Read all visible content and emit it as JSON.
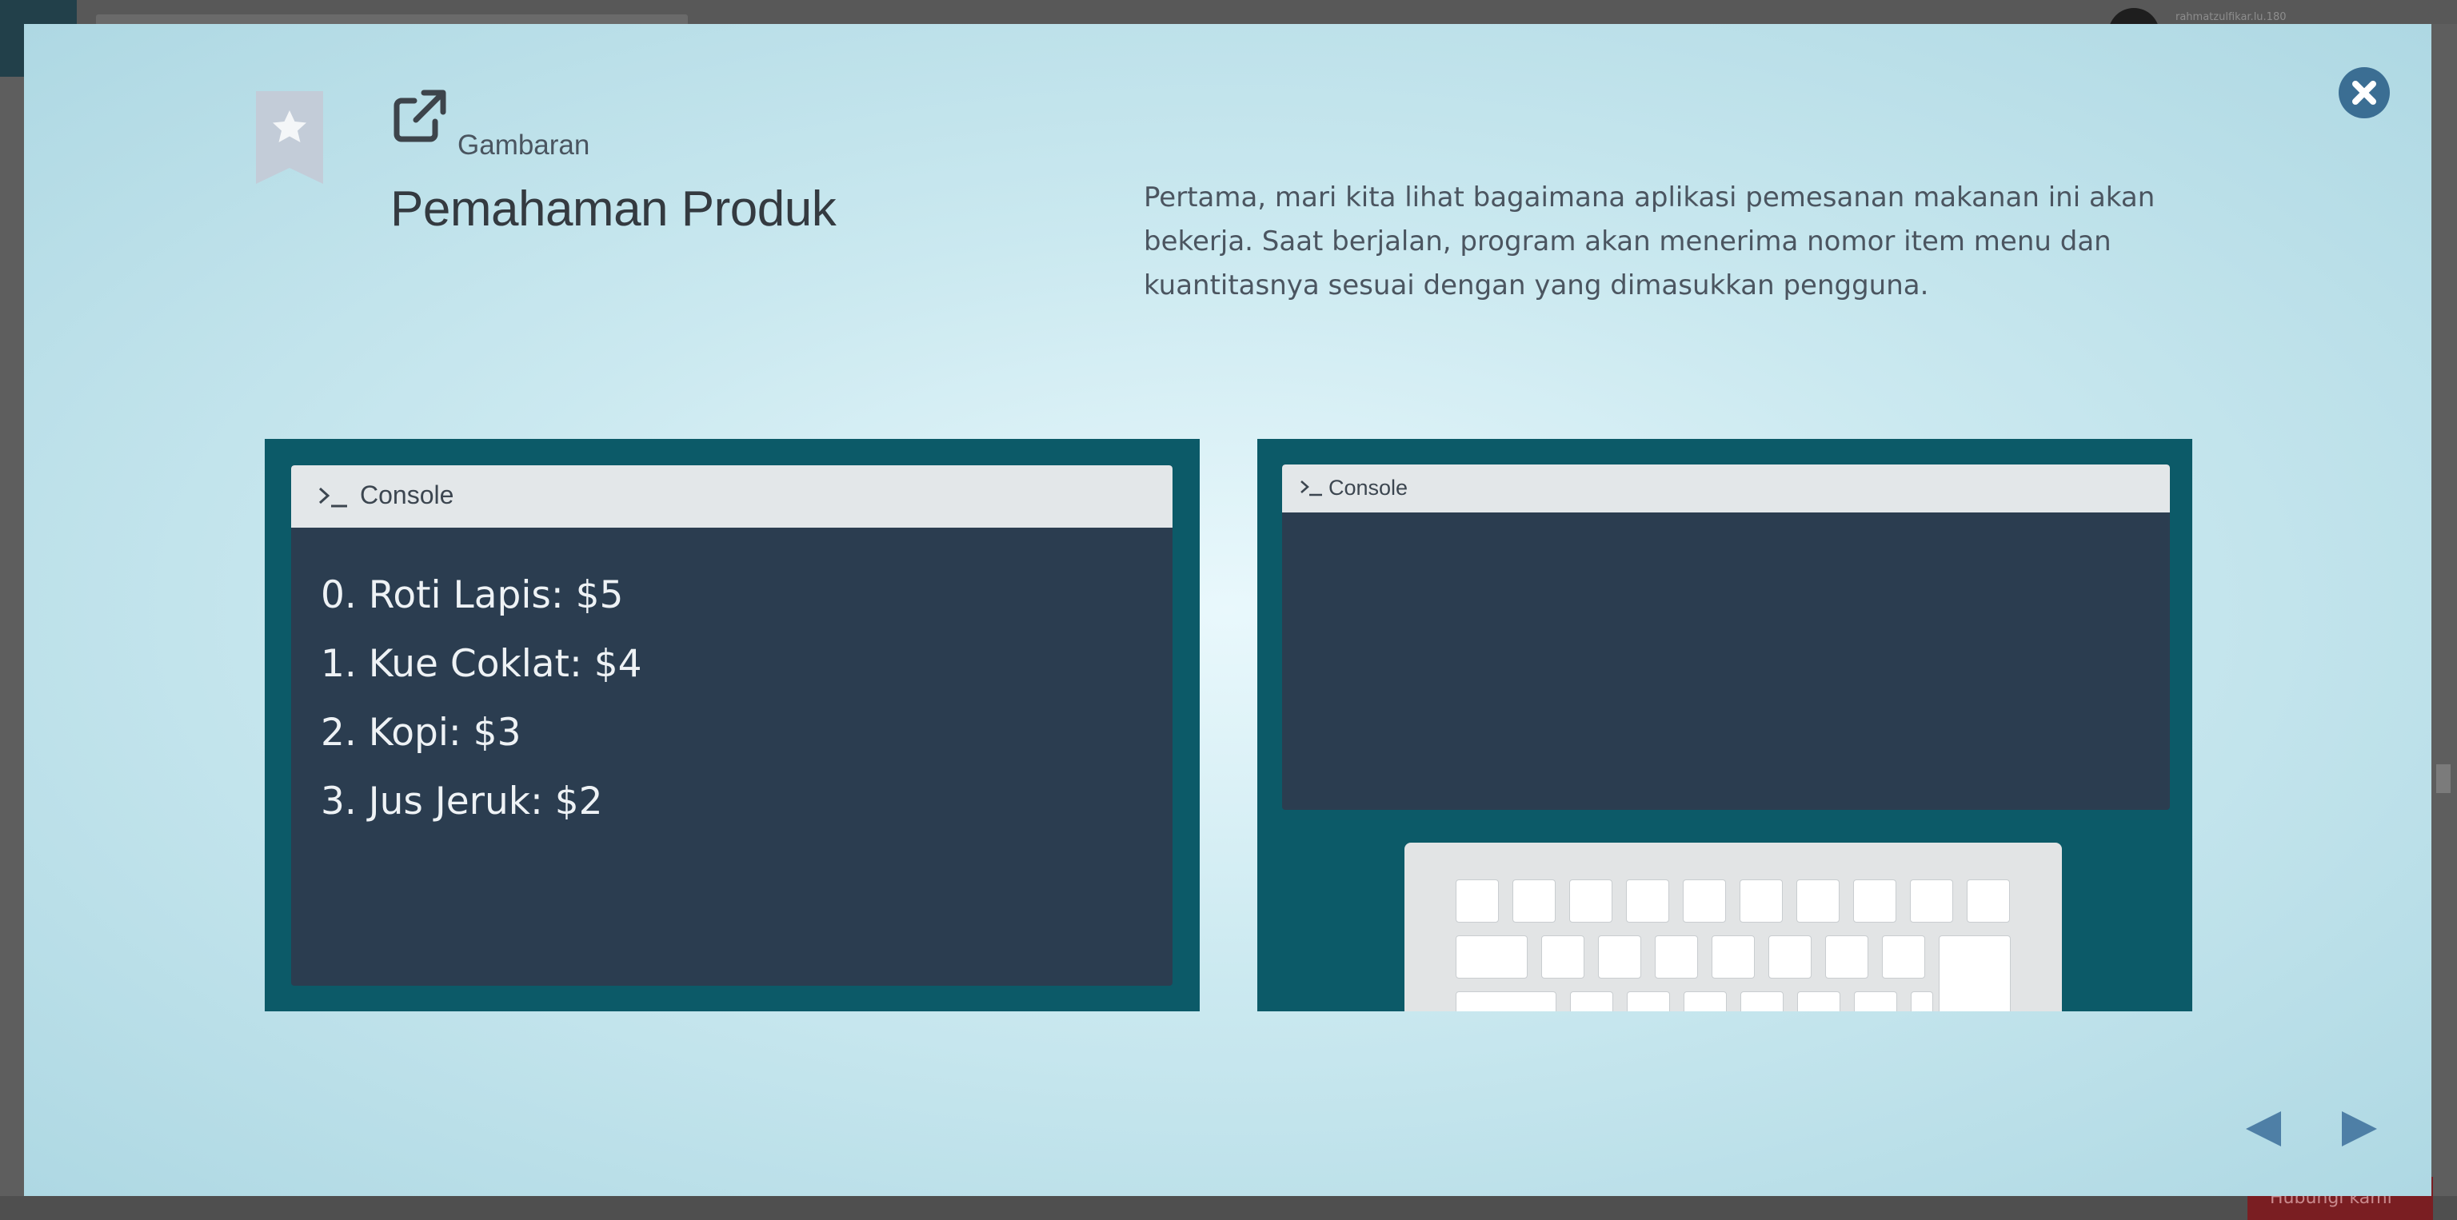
{
  "backdrop": {
    "user_name": "rahmatzulfikar.lu.180",
    "help_label": "Hubungi kami"
  },
  "modal": {
    "eyebrow": "Gambaran",
    "title": "Pemahaman Produk",
    "intro": "Pertama, mari kita lihat bagaimana aplikasi pemesanan makanan ini akan bekerja. Saat berjalan, program akan menerima nomor item menu dan kuantitasnya sesuai dengan yang dimasukkan pengguna.",
    "icons": {
      "bookmark": "bookmark-star-icon",
      "external": "external-link-icon",
      "close": "close-icon",
      "prev": "prev-arrow-icon",
      "next": "next-arrow-icon",
      "prompt": "terminal-prompt-icon"
    },
    "colors": {
      "panel": "#0c5a68",
      "console": "#2b3d50",
      "close": "#3b6e93",
      "nav": "#4e7fa6"
    }
  },
  "console_left": {
    "title": "Console",
    "items": [
      "0. Roti Lapis: $5",
      "1. Kue Coklat: $4",
      "2. Kopi: $3",
      "3. Jus Jeruk: $2"
    ]
  },
  "console_right": {
    "title": "Console"
  }
}
